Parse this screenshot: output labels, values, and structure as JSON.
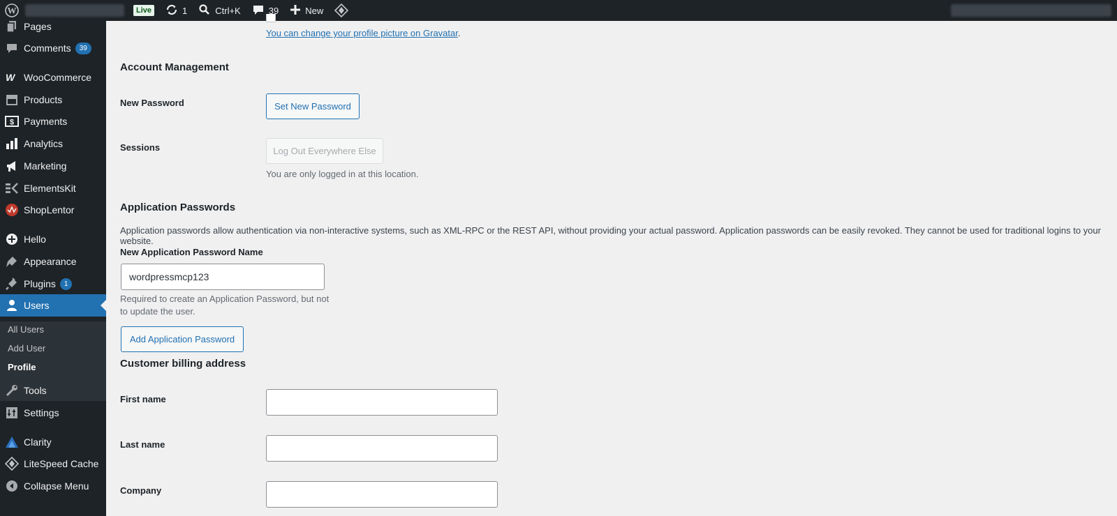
{
  "admin_bar": {
    "live_label": "Live",
    "updates_count": "1",
    "search_shortcut": "Ctrl+K",
    "comments_count": "39",
    "new_label": "New"
  },
  "sidebar": {
    "items": [
      {
        "label": "Pages",
        "icon": "pages-icon"
      },
      {
        "label": "Comments",
        "icon": "comments-icon",
        "badge": "39"
      },
      {
        "label": "WooCommerce",
        "icon": "woocommerce-icon"
      },
      {
        "label": "Products",
        "icon": "products-icon"
      },
      {
        "label": "Payments",
        "icon": "payments-icon"
      },
      {
        "label": "Analytics",
        "icon": "analytics-icon"
      },
      {
        "label": "Marketing",
        "icon": "marketing-icon"
      },
      {
        "label": "ElementsKit",
        "icon": "elementskit-icon"
      },
      {
        "label": "ShopLentor",
        "icon": "shoplentor-icon"
      },
      {
        "label": "Hello",
        "icon": "hello-icon"
      },
      {
        "label": "Appearance",
        "icon": "appearance-icon"
      },
      {
        "label": "Plugins",
        "icon": "plugins-icon",
        "badge": "1"
      },
      {
        "label": "Users",
        "icon": "users-icon"
      },
      {
        "label": "Tools",
        "icon": "tools-icon"
      },
      {
        "label": "Settings",
        "icon": "settings-icon"
      },
      {
        "label": "Clarity",
        "icon": "clarity-icon"
      },
      {
        "label": "LiteSpeed Cache",
        "icon": "litespeed-icon"
      },
      {
        "label": "Collapse Menu",
        "icon": "collapse-icon"
      }
    ],
    "submenu": [
      "All Users",
      "Add User",
      "Profile"
    ]
  },
  "content": {
    "gravatar_link": "You can change your profile picture on Gravatar",
    "gravatar_period": ".",
    "account_heading": "Account Management",
    "new_password_label": "New Password",
    "set_new_password_button": "Set New Password",
    "sessions_label": "Sessions",
    "logout_button": "Log Out Everywhere Else",
    "sessions_desc": "You are only logged in at this location.",
    "app_passwords_heading": "Application Passwords",
    "app_passwords_desc": "Application passwords allow authentication via non-interactive systems, such as XML-RPC or the REST API, without providing your actual password. Application passwords can be easily revoked. They cannot be used for traditional logins to your website.",
    "app_name_label": "New Application Password Name",
    "app_name_value": "wordpressmcp123",
    "app_name_desc_1": "Required to create an Application Password, but not",
    "app_name_desc_2": "to update the user.",
    "add_app_password_button": "Add Application Password",
    "billing_heading": "Customer billing address",
    "first_name_label": "First name",
    "last_name_label": "Last name",
    "company_label": "Company",
    "first_name_value": "",
    "last_name_value": "",
    "company_value": ""
  }
}
